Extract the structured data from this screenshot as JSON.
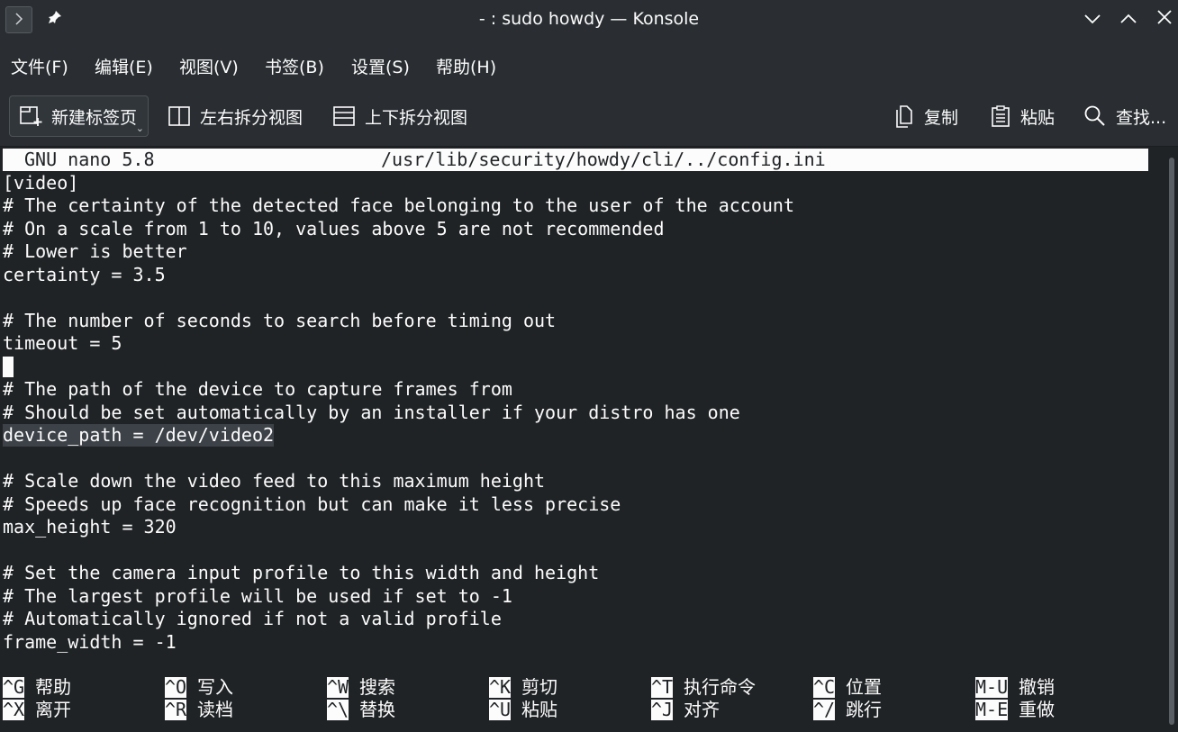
{
  "window": {
    "title": "- : sudo howdy — Konsole"
  },
  "menubar": {
    "items": [
      "文件(F)",
      "编辑(E)",
      "视图(V)",
      "书签(B)",
      "设置(S)",
      "帮助(H)"
    ]
  },
  "toolbar": {
    "new_tab": "新建标签页",
    "split_lr": "左右拆分视图",
    "split_tb": "上下拆分视图",
    "copy": "复制",
    "paste": "粘贴",
    "find": "查找..."
  },
  "nano": {
    "version": "GNU nano 5.8",
    "file": "/usr/lib/security/howdy/cli/../config.ini",
    "lines": [
      "[video]",
      "# The certainty of the detected face belonging to the user of the account",
      "# On a scale from 1 to 10, values above 5 are not recommended",
      "# Lower is better",
      "certainty = 3.5",
      "",
      "# The number of seconds to search before timing out",
      "timeout = 5",
      "",
      "# The path of the device to capture frames from",
      "# Should be set automatically by an installer if your distro has one",
      "device_path = /dev/video2",
      "",
      "# Scale down the video feed to this maximum height",
      "# Speeds up face recognition but can make it less precise",
      "max_height = 320",
      "",
      "# Set the camera input profile to this width and height",
      "# The largest profile will be used if set to -1",
      "# Automatically ignored if not a valid profile",
      "frame_width = -1"
    ],
    "shortcuts_row1": [
      {
        "key": "^G",
        "label": "帮助"
      },
      {
        "key": "^O",
        "label": "写入"
      },
      {
        "key": "^W",
        "label": "搜索"
      },
      {
        "key": "^K",
        "label": "剪切"
      },
      {
        "key": "^T",
        "label": "执行命令"
      },
      {
        "key": "^C",
        "label": "位置"
      },
      {
        "key": "M-U",
        "label": "撤销"
      }
    ],
    "shortcuts_row2": [
      {
        "key": "^X",
        "label": "离开"
      },
      {
        "key": "^R",
        "label": "读档"
      },
      {
        "key": "^\\",
        "label": "替换"
      },
      {
        "key": "^U",
        "label": "粘贴"
      },
      {
        "key": "^J",
        "label": "对齐"
      },
      {
        "key": "^/",
        "label": "跳行"
      },
      {
        "key": "M-E",
        "label": "重做"
      }
    ]
  },
  "colors": {
    "background": "#202326",
    "chrome": "#2a2e32",
    "text": "#fcfcfc"
  }
}
